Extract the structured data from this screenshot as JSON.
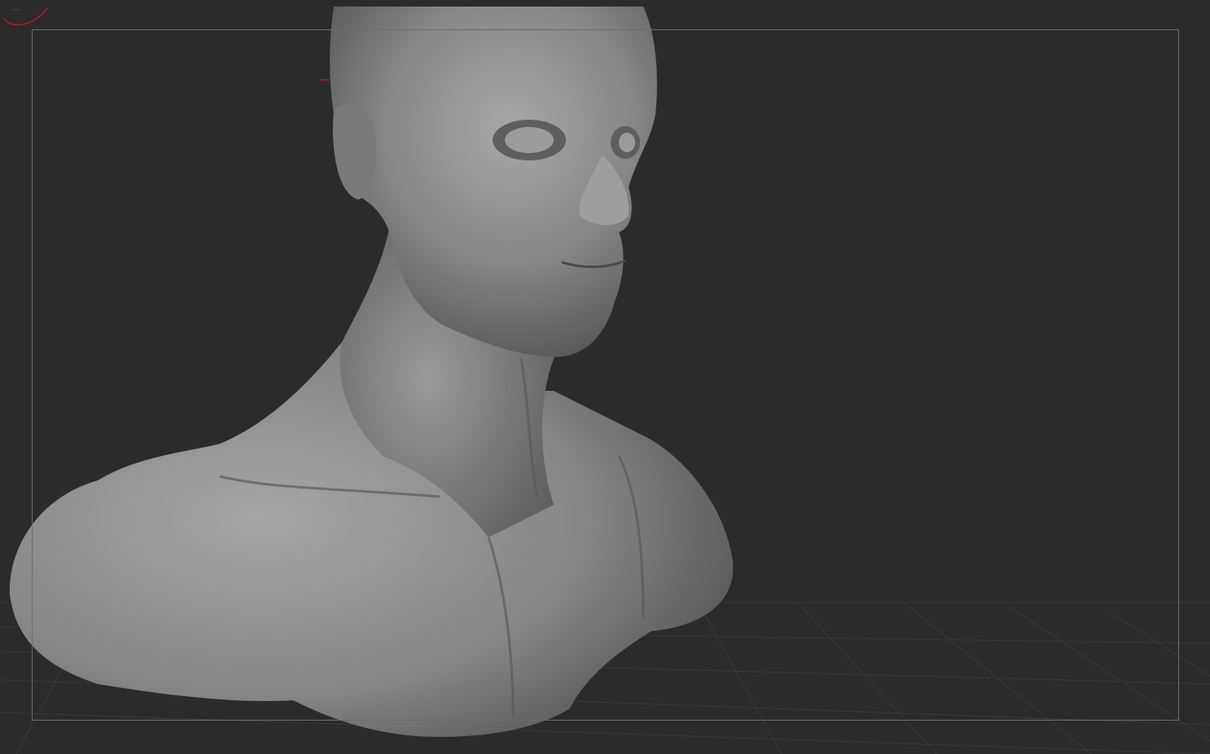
{
  "viewport": {
    "background_color": "#2b2b2b",
    "frame_color": "#6c6c6c",
    "grid_color": "#3a3a3a",
    "model_base_color": "#8a8a8a",
    "gizmo_color": "#b01e24"
  },
  "model": {
    "icon": "sculpted-bust-model"
  },
  "gizmo": {
    "icon": "axis-orientation-gizmo"
  }
}
